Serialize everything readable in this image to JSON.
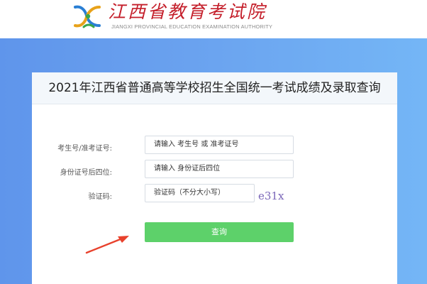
{
  "header": {
    "logo_title": "江西省教育考试院",
    "logo_subtitle": "JIANGXI PROVINCIAL EDUCATION EXAMINATION AUTHORITY",
    "brand_color": "#c41e2a",
    "logo_icon": "jx-logo-icon"
  },
  "background": {
    "gradient_from": "#5f95eb",
    "gradient_to": "#74b6f6"
  },
  "form": {
    "title": "2021年江西省普通高等学校招生全国统一考试成绩及录取查询",
    "fields": [
      {
        "label": "考生号/准考证号:",
        "placeholder": "请输入 考生号 或 准考证号"
      },
      {
        "label": "身份证号后四位:",
        "placeholder": "请输入 身份证后四位"
      },
      {
        "label": "验证码:",
        "placeholder": "验证码（不分大小写）"
      }
    ],
    "captcha_text": "e31x",
    "submit_label": "查询",
    "submit_color": "#5dd16a"
  },
  "annotation": {
    "arrow_color": "#e8412c",
    "arrow_icon": "red-arrow-icon"
  }
}
